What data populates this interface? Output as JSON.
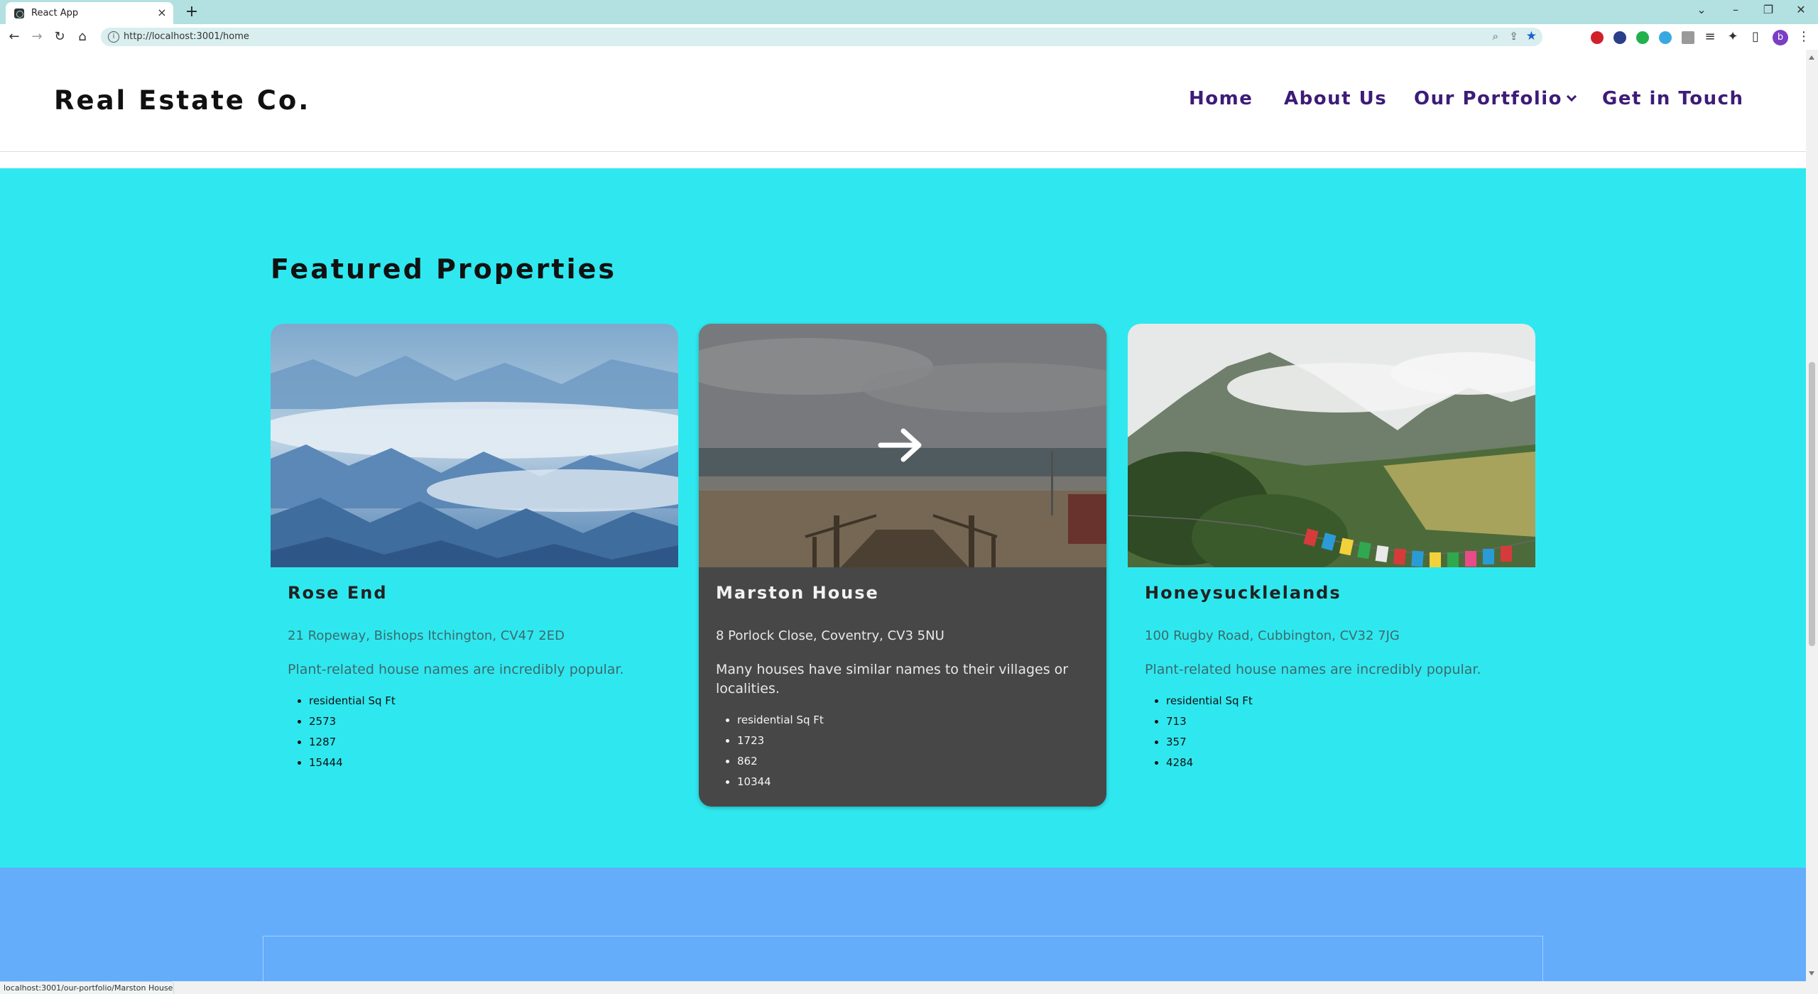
{
  "browser": {
    "tab_title": "React App",
    "url": "http://localhost:3001/home",
    "status_url": "localhost:3001/our-portfolio/Marston House",
    "profile_initial": "b"
  },
  "site": {
    "logo": "Real Estate Co.",
    "nav": {
      "home": "Home",
      "about": "About Us",
      "portfolio": "Our Portfolio",
      "contact": "Get in Touch"
    }
  },
  "featured": {
    "title": "Featured Properties",
    "properties": [
      {
        "name": "Rose End",
        "address": "21 Ropeway, Bishops Itchington, CV47 2ED",
        "description": "Plant-related house names are incredibly popular.",
        "details": [
          "residential Sq Ft",
          "2573",
          "1287",
          "15444"
        ],
        "image": "misty-blue-mountains"
      },
      {
        "name": "Marston House",
        "address": "8 Porlock Close, Coventry, CV3 5NU",
        "description": "Many houses have similar names to their villages or localities.",
        "details": [
          "residential Sq Ft",
          "1723",
          "862",
          "10344"
        ],
        "image": "beach-boardwalk"
      },
      {
        "name": "Honeysucklelands",
        "address": "100 Rugby Road, Cubbington, CV32 7JG",
        "description": "Plant-related house names are incredibly popular.",
        "details": [
          "residential Sq Ft",
          "713",
          "357",
          "4284"
        ],
        "image": "green-valley-prayer-flags"
      }
    ]
  },
  "colors": {
    "featured_bg": "#2fe8ef",
    "active_card_bg": "#474747",
    "nav_text": "#3d1b78",
    "lower_section_bg": "#63adfb"
  }
}
